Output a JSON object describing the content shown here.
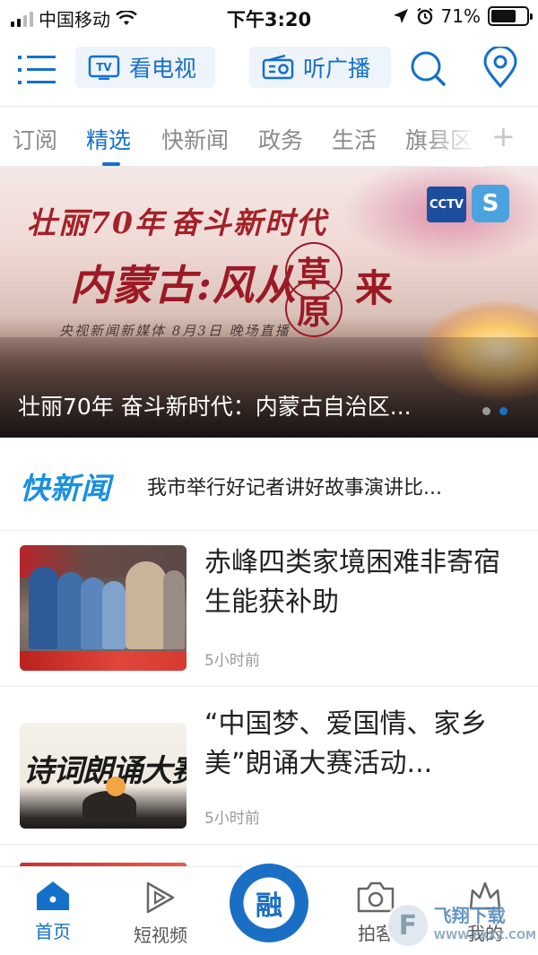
{
  "status_bar": {
    "carrier": "中国移动",
    "time": "下午3:20",
    "battery": "71%",
    "battery_level": 0.71
  },
  "top_nav": {
    "menu_icon": "hamburger-menu-icon",
    "tv_label": "看电视",
    "tv_icon_text": "TV",
    "radio_label": "听广播",
    "search_icon": "search-icon",
    "location_icon": "location-pin-icon"
  },
  "tabs": {
    "items": [
      "订阅",
      "精选",
      "快新闻",
      "政务",
      "生活",
      "旗县区"
    ],
    "active": "精选",
    "add_label": "+"
  },
  "banner": {
    "slogan_a": "壮丽70年",
    "slogan_b": "奋斗新时代",
    "headline": "内蒙古:风从",
    "circle_1": "草",
    "circle_2": "原",
    "headline_end": "来",
    "sub": "央视新闻新媒体  8月3日  晚场直播",
    "logo_1": "CCTV",
    "caption": "壮丽70年 奋斗新时代：内蒙古自治区...",
    "dots": 2,
    "active_dot": 2
  },
  "quick_news": {
    "logo": "快新闻",
    "headline": "我市举行好记者讲好故事演讲比..."
  },
  "news": [
    {
      "title": "赤峰四类家境困难非寄宿生能获补助",
      "time": "5小时前"
    },
    {
      "title": "“中国梦、爱国情、家乡美”朗诵大赛活动...",
      "time": "5小时前",
      "thumb_text": "诗词朗诵大赛"
    }
  ],
  "bottom_bar": {
    "items": [
      {
        "label": "首页",
        "icon": "home-icon"
      },
      {
        "label": "短视频",
        "icon": "play-icon"
      },
      {
        "label": "",
        "icon": "rong-center-icon",
        "text": "融"
      },
      {
        "label": "拍客",
        "icon": "camera-icon"
      },
      {
        "label": "我的",
        "icon": "crown-icon"
      }
    ],
    "active": "首页"
  },
  "watermark": {
    "title": "飞翔下载",
    "url": "WWW.FXXZ.COM"
  },
  "colors": {
    "accent": "#1570c9",
    "quick_logo": "#1a8fe0",
    "banner_red": "#9b1a26"
  }
}
